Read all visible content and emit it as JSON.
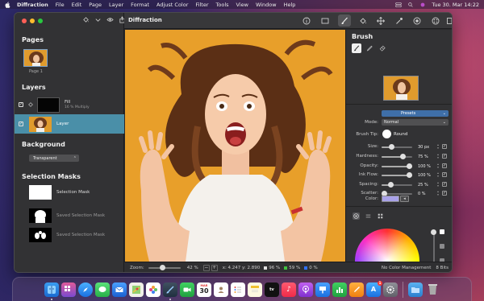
{
  "menubar": {
    "app_name": "Diffraction",
    "items": [
      "File",
      "Edit",
      "Page",
      "Layer",
      "Format",
      "Adjust Color",
      "Filter",
      "Tools",
      "View",
      "Window",
      "Help"
    ],
    "clock": "Tue 30. Mar 14:22"
  },
  "window": {
    "title": "Diffraction"
  },
  "sidebar": {
    "pages_title": "Pages",
    "page_label": "Page 1",
    "layers_title": "Layers",
    "layers": [
      {
        "name": "Fill",
        "sub": "16 % Multiply",
        "visible": true,
        "selected": false
      },
      {
        "name": "Layer",
        "sub": "",
        "visible": true,
        "selected": true
      }
    ],
    "background_title": "Background",
    "background_value": "Transparent",
    "selection_masks_title": "Selection Masks",
    "masks": [
      {
        "name": "Selection Mask",
        "dim": false
      },
      {
        "name": "Saved Selection Mask",
        "dim": true
      },
      {
        "name": "Saved Selection Mask",
        "dim": true
      }
    ]
  },
  "statusbar": {
    "zoom_label": "Zoom:",
    "zoom_value": "42 %",
    "zoom_fraction": 0.42,
    "minus": "−",
    "plus": "+",
    "coords": "x: 4.247  y: 2.890",
    "channels": [
      {
        "value": "96 %",
        "color": "#e0e0e0"
      },
      {
        "value": "59 %",
        "color": "#40c040"
      },
      {
        "value": "0 %",
        "color": "#3070ff"
      }
    ],
    "color_management": "No Color Management",
    "bits": "8 Bits"
  },
  "inspector": {
    "title": "Brush",
    "presets_label": "Presets",
    "mode_label": "Mode:",
    "mode_value": "Normal",
    "tip_label": "Brush Tip:",
    "tip_value": "Round",
    "properties": [
      {
        "label": "Size:",
        "value": "30 px",
        "fraction": 0.3
      },
      {
        "label": "Hardness:",
        "value": "75 %",
        "fraction": 0.75
      },
      {
        "label": "Opacity:",
        "value": "100 %",
        "fraction": 1.0
      },
      {
        "label": "Ink Flow:",
        "value": "100 %",
        "fraction": 1.0
      },
      {
        "label": "Spacing:",
        "value": "25 %",
        "fraction": 0.25
      },
      {
        "label": "Scatter:",
        "value": "0 %",
        "fraction": 0.0
      }
    ],
    "color_label": "Color:",
    "color_value": "#a9a2e8"
  },
  "colors": {
    "canvas_bg": "#e89f2a",
    "selected_row": "#4a8fa8",
    "accent_blue": "#3f6fa8"
  },
  "dock": {
    "calendar_month": "MAR",
    "calendar_day": "30",
    "appstore_badge": "1"
  }
}
